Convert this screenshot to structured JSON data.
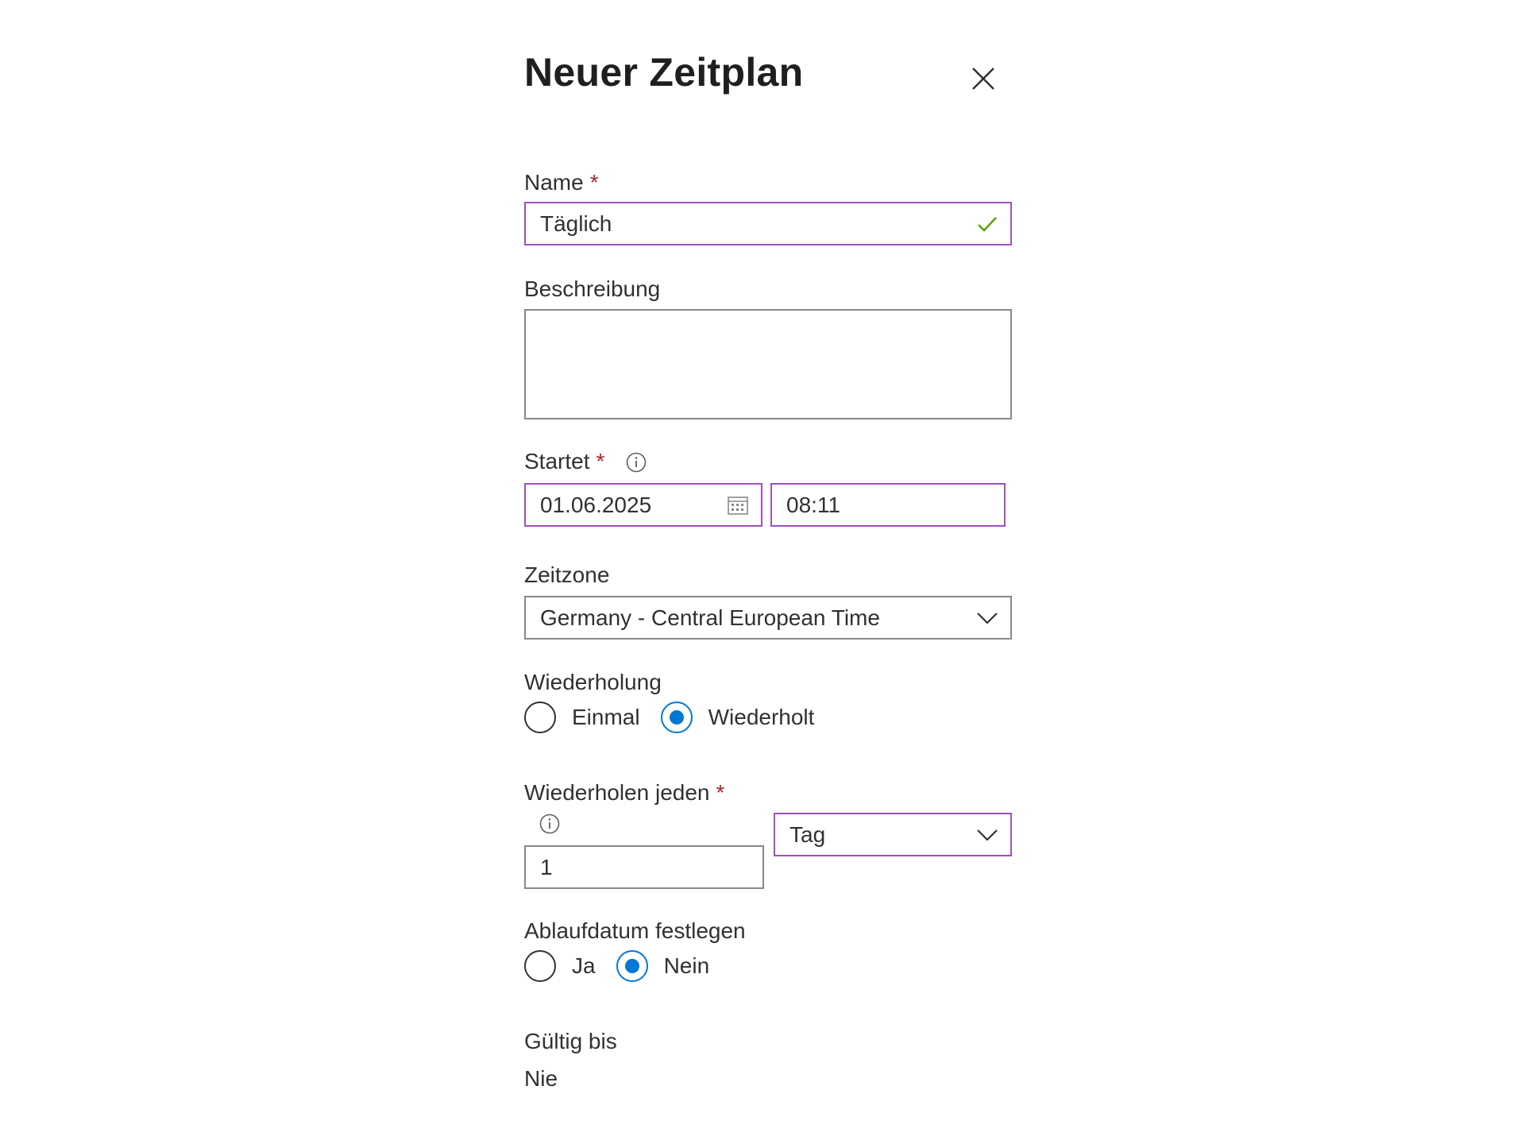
{
  "dialog": {
    "title": "Neuer Zeitplan"
  },
  "fields": {
    "name": {
      "label": "Name",
      "required_mark": "*",
      "value": "Täglich"
    },
    "description": {
      "label": "Beschreibung",
      "value": ""
    },
    "start": {
      "label": "Startet",
      "required_mark": "*",
      "date": "01.06.2025",
      "time": "08:11"
    },
    "timezone": {
      "label": "Zeitzone",
      "selected": "Germany - Central European Time"
    },
    "recurrence": {
      "label": "Wiederholung",
      "options": [
        "Einmal",
        "Wiederholt"
      ],
      "selected": "Wiederholt"
    },
    "repeat_every": {
      "label": "Wiederholen jeden",
      "required_mark": "*",
      "interval": "1",
      "unit": "Tag"
    },
    "expiration": {
      "label": "Ablaufdatum festlegen",
      "options": [
        "Ja",
        "Nein"
      ],
      "selected": "Nein"
    },
    "valid_until": {
      "label": "Gültig bis",
      "value": "Nie"
    }
  },
  "icons": {
    "close": "close-icon",
    "valid": "checkmark-icon",
    "info": "info-icon",
    "calendar": "calendar-icon",
    "dropdown": "chevron-down-icon"
  },
  "colors": {
    "focus_border": "#a04fc0",
    "radio_checked": "#0078d4",
    "required": "#a4262c",
    "valid_check": "#57a300"
  }
}
